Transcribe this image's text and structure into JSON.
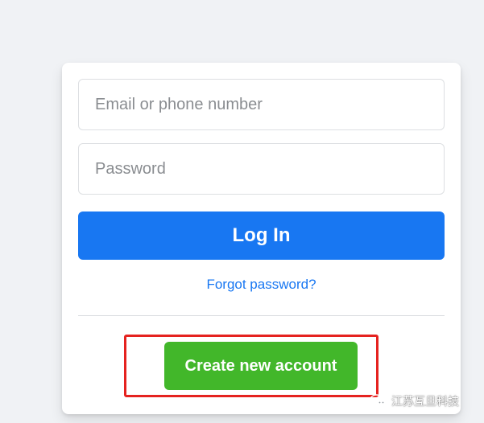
{
  "login_form": {
    "email_placeholder": "Email or phone number",
    "password_placeholder": "Password",
    "login_label": "Log In",
    "forgot_password_label": "Forgot password?",
    "create_account_label": "Create new account"
  },
  "watermark": {
    "icon": "wechat-icon",
    "text": "江苏互旦科技"
  },
  "colors": {
    "page_background": "#f0f2f5",
    "primary_blue": "#1877f2",
    "create_green": "#42b72a",
    "highlight_red": "#e5221f"
  }
}
